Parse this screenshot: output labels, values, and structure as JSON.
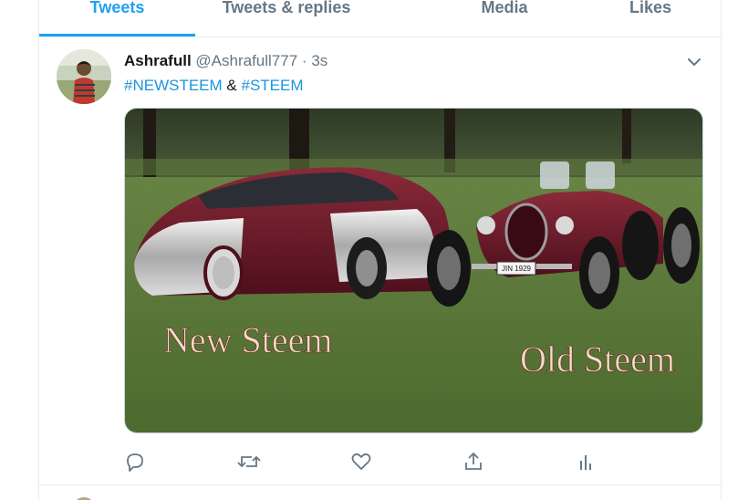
{
  "tabs": [
    {
      "label": "Tweets",
      "active": true
    },
    {
      "label": "Tweets & replies",
      "active": false
    },
    {
      "label": "Media",
      "active": false
    },
    {
      "label": "Likes",
      "active": false
    }
  ],
  "tweet": {
    "author_name": "Ashrafull",
    "handle": "@Ashrafull777",
    "separator": "·",
    "time": "3s",
    "hashtag1": "#NEWSTEEM",
    "connector": "&",
    "hashtag2": "#STEEM",
    "media": {
      "left_caption": "New Steem",
      "right_caption": "Old Steem",
      "plate_text": "JIN 1929"
    },
    "actions": [
      "reply-icon",
      "retweet-icon",
      "like-icon",
      "share-icon",
      "analytics-icon"
    ]
  },
  "colors": {
    "accent": "#1da1f2",
    "link": "#1b95e0",
    "muted": "#657786",
    "border": "#e6ecf0"
  }
}
